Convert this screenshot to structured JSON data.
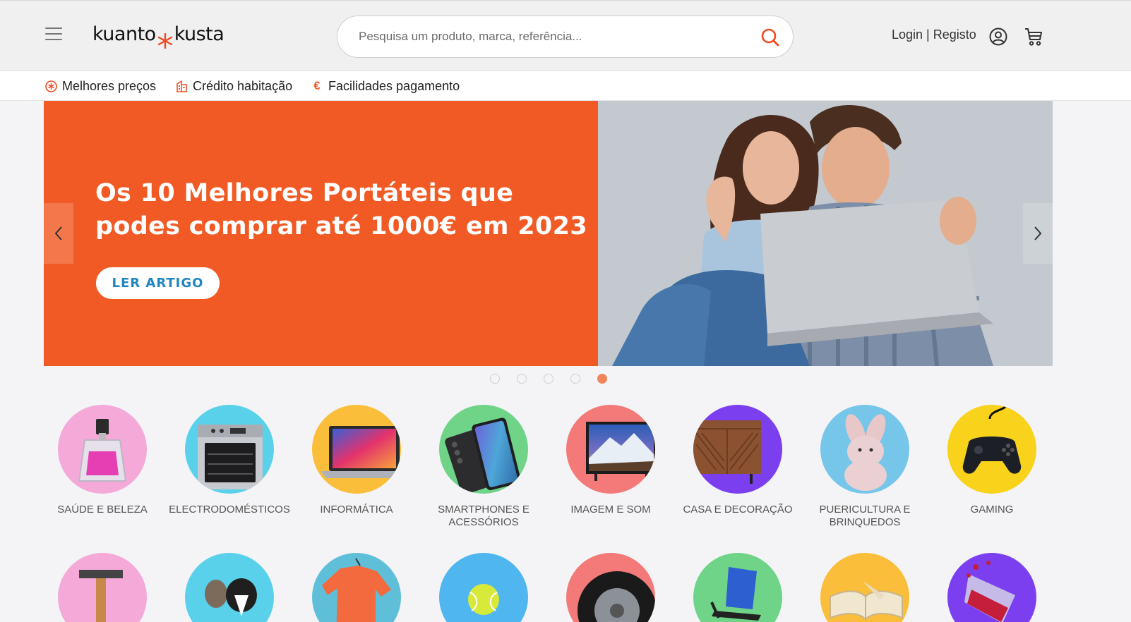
{
  "header": {
    "logo_left": "kuanto",
    "logo_right": "kusta",
    "search_placeholder": "Pesquisa um produto, marca, referência...",
    "login_label": "Login | Registo"
  },
  "subnav": [
    {
      "label": "Melhores preços",
      "icon": "asterisk-badge-icon"
    },
    {
      "label": "Crédito habitação",
      "icon": "building-icon"
    },
    {
      "label": "Facilidades pagamento",
      "icon": "euro-icon",
      "symbol": "€"
    }
  ],
  "banner": {
    "headline_line1": "Os 10 Melhores Portáteis que",
    "headline_line2": "podes comprar até 1000€ em 2023",
    "cta": "LER ARTIGO",
    "active_slide": 5,
    "slide_count": 5
  },
  "categories_row1": [
    {
      "label": "SAÚDE E BELEZA",
      "color": "#f4a9d8"
    },
    {
      "label": "ELECTRODOMÉSTICOS",
      "color": "#5ad1ea"
    },
    {
      "label": "INFORMÁTICA",
      "color": "#fbbe3a"
    },
    {
      "label_line1": "SMARTPHONES E",
      "label_line2": "ACESSÓRIOS",
      "color": "#6fd488"
    },
    {
      "label": "IMAGEM E SOM",
      "color": "#f47a7a"
    },
    {
      "label": "CASA E DECORAÇÃO",
      "color": "#7b3ff0"
    },
    {
      "label_line1": "PUERICULTURA E",
      "label_line2": "BRINQUEDOS",
      "color": "#76c6ea"
    },
    {
      "label": "GAMING",
      "color": "#f8d21b"
    }
  ],
  "categories_row2_colors": [
    "#f4a9d8",
    "#5ad1ea",
    "#5fbfd8",
    "#4fb6f0",
    "#f47a7a",
    "#6fd488",
    "#fbbe3a",
    "#7b3ff0"
  ],
  "colors": {
    "accent": "#f15a24",
    "link": "#1f87c0"
  }
}
